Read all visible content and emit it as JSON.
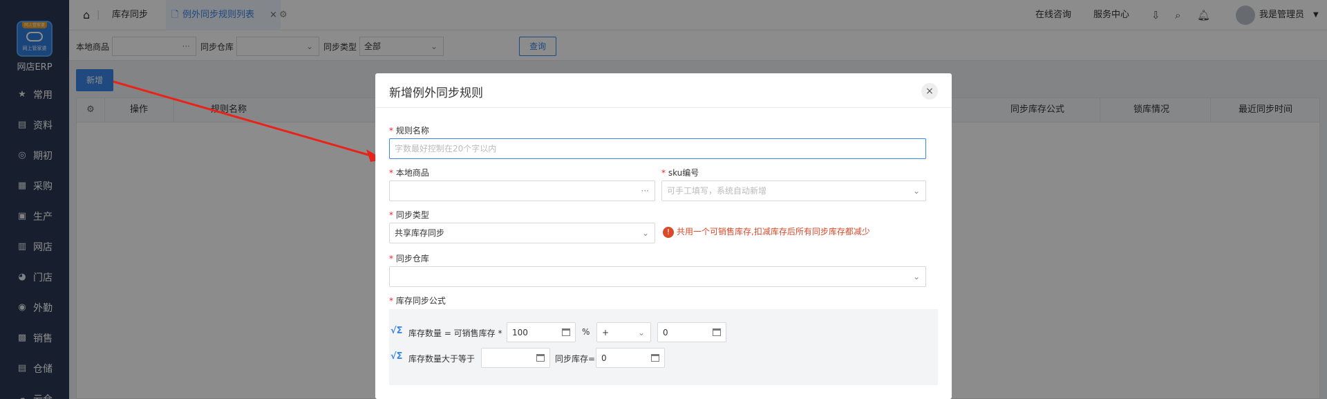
{
  "app": {
    "brand": "网店ERP",
    "logo_cap": "网上管家婆",
    "logo_text": "网上管家婆"
  },
  "sidebar": {
    "items": [
      {
        "label": "常用",
        "icon": "star-icon"
      },
      {
        "label": "资料",
        "icon": "doc-icon"
      },
      {
        "label": "期初",
        "icon": "target-icon"
      },
      {
        "label": "采购",
        "icon": "cart-icon"
      },
      {
        "label": "生产",
        "icon": "factory-icon"
      },
      {
        "label": "网店",
        "icon": "shop-icon"
      },
      {
        "label": "门店",
        "icon": "pie-icon"
      },
      {
        "label": "外勤",
        "icon": "location-icon"
      },
      {
        "label": "销售",
        "icon": "chart-icon"
      },
      {
        "label": "仓储",
        "icon": "warehouse-icon"
      },
      {
        "label": "云仓",
        "icon": "cloud-icon"
      }
    ]
  },
  "topbar": {
    "tabs": [
      "库存同步",
      "例外同步规则列表"
    ],
    "links": [
      "在线咨询",
      "服务中心"
    ],
    "user": "我是管理员"
  },
  "filter": {
    "local_goods_label": "本地商品",
    "warehouse_label": "同步仓库",
    "type_label": "同步类型",
    "type_value": "全部",
    "query": "查询"
  },
  "add_button": "新增",
  "table": {
    "headers_left": [
      "操作",
      "规则名称"
    ],
    "headers_right": [
      "同步库存公式",
      "锁库情况",
      "最近同步时间"
    ]
  },
  "modal": {
    "title": "新增例外同步规则",
    "rule_name_label": "规则名称",
    "rule_name_placeholder": "字数最好控制在20个字以内",
    "local_goods_label": "本地商品",
    "sku_label": "sku编号",
    "sku_placeholder": "可手工填写，系统自动新增",
    "sync_type_label": "同步类型",
    "sync_type_value": "共享库存同步",
    "sync_type_hint": "共用一个可销售库存,扣减库存后所有同步库存都减少",
    "warehouse_label": "同步仓库",
    "formula_label": "库存同步公式",
    "formula1_text": "库存数量 = 可销售库存 *",
    "formula1_value": "100",
    "percent": "%",
    "operator": "+",
    "formula1_add": "0",
    "formula2_text": "库存数量大于等于",
    "formula2_value": "",
    "formula2_sync_label": "同步库存=",
    "formula2_sync_value": "0"
  },
  "colors": {
    "accent": "#3a86e8",
    "sidebar": "#2b3a55",
    "arrow": "#e8231a",
    "hint": "#d94a2b"
  }
}
